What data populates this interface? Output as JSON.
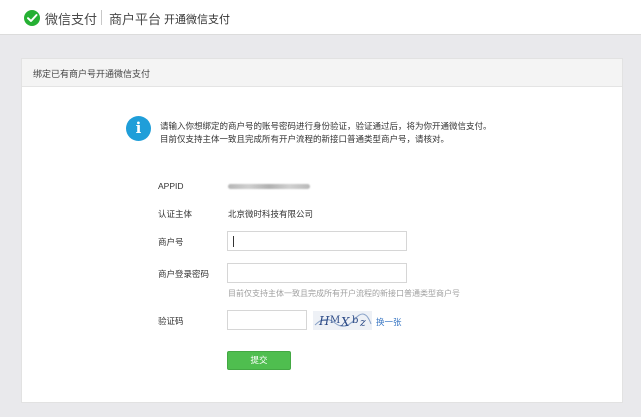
{
  "header": {
    "brand": "微信支付",
    "platform": "商户平台",
    "subtitle": "开通微信支付"
  },
  "card": {
    "title": "绑定已有商户号开通微信支付",
    "info_lines": [
      "请输入你想绑定的商户号的账号密码进行身份验证，验证通过后，将为你开通微信支付。",
      "目前仅支持主体一致且完成所有开户流程的新接口普通类型商户号，请核对。"
    ],
    "info_icon_glyph": "i"
  },
  "form": {
    "appid_label": "APPID",
    "entity_label": "认证主体",
    "entity_value": "北京微时科技有限公司",
    "merchant_label": "商户号",
    "merchant_value": "",
    "password_label": "商户登录密码",
    "password_value": "",
    "hint": "目前仅支持主体一致且完成所有开户流程的新接口普通类型商户号",
    "captcha_label": "验证码",
    "captcha_value": "",
    "refresh_label": "换一张",
    "submit_label": "提交"
  },
  "colors": {
    "accent_green": "#4fbe4f",
    "info_blue": "#1f9ed9",
    "link_blue": "#3b78c4"
  }
}
